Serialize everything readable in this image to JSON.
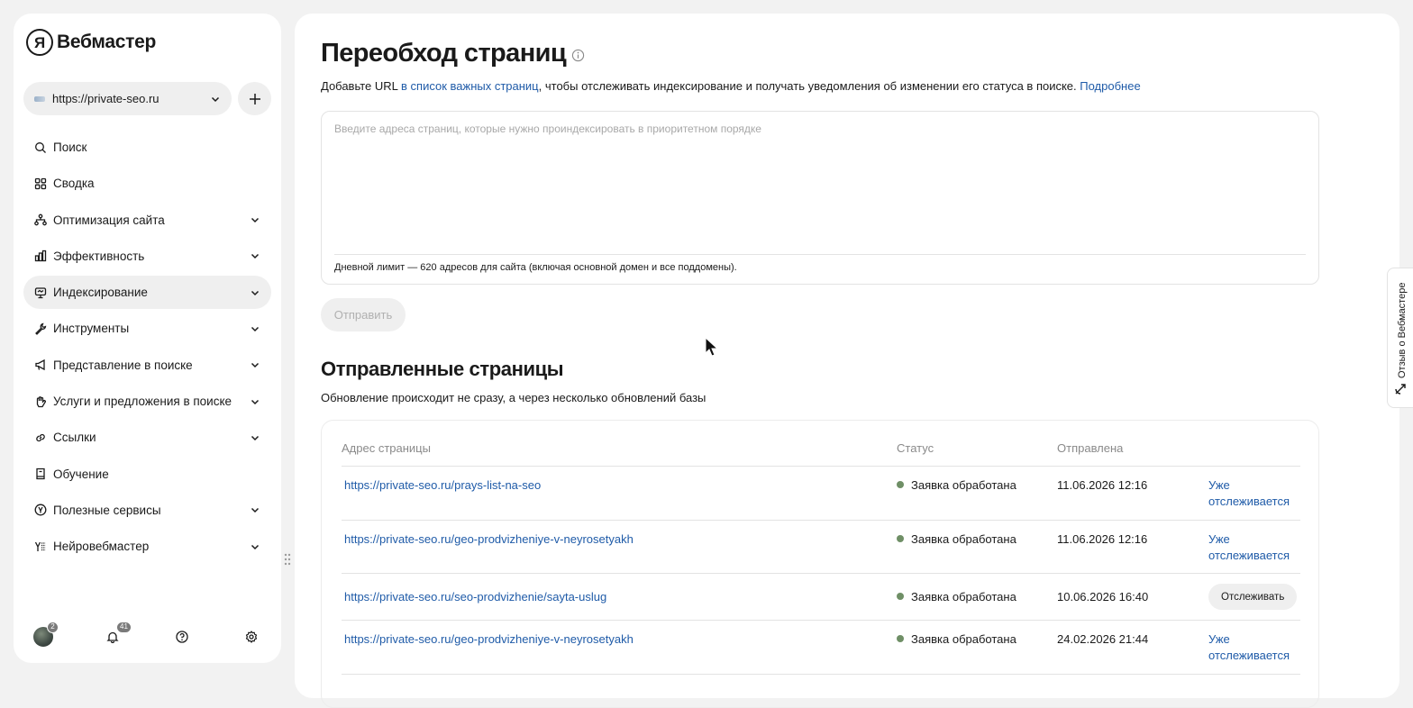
{
  "brand": {
    "logo_letter": "Я",
    "name": "Вебмастер"
  },
  "site_selector": {
    "value": "https://private-seo.ru"
  },
  "nav": [
    {
      "label": "Поиск",
      "icon": "search-icon",
      "expandable": false,
      "active": false
    },
    {
      "label": "Сводка",
      "icon": "grid-icon",
      "expandable": false,
      "active": false
    },
    {
      "label": "Оптимизация сайта",
      "icon": "sitemap-icon",
      "expandable": true,
      "active": false
    },
    {
      "label": "Эффективность",
      "icon": "bar-chart-icon",
      "expandable": true,
      "active": false
    },
    {
      "label": "Индексирование",
      "icon": "monitor-icon",
      "expandable": true,
      "active": true
    },
    {
      "label": "Инструменты",
      "icon": "wrench-icon",
      "expandable": true,
      "active": false
    },
    {
      "label": "Представление в поиске",
      "icon": "megaphone-icon",
      "expandable": true,
      "active": false
    },
    {
      "label": "Услуги и предложения в поиске",
      "icon": "hand-icon",
      "expandable": true,
      "active": false
    },
    {
      "label": "Ссылки",
      "icon": "link-icon",
      "expandable": true,
      "active": false
    },
    {
      "label": "Обучение",
      "icon": "book-icon",
      "expandable": false,
      "active": false
    },
    {
      "label": "Полезные сервисы",
      "icon": "yandex-icon",
      "expandable": true,
      "active": false
    },
    {
      "label": "Нейровебмастер",
      "icon": "neuro-icon",
      "expandable": true,
      "active": false
    }
  ],
  "bottom_bar": {
    "avatar_badge": "2",
    "notifications_badge": "41"
  },
  "page": {
    "title": "Переобход страниц",
    "desc_prefix": "Добавьте URL ",
    "desc_link": "в список важных страниц",
    "desc_suffix": ", чтобы отслеживать индексирование и получать уведомления об изменении его статуса в поиске. ",
    "desc_more": "Подробнее",
    "input_placeholder": "Введите адреса страниц, которые нужно проиндексировать в приоритетном порядке",
    "input_value": "",
    "limit_text": "Дневной лимит — 620 адресов для сайта (включая основной домен и все поддомены).",
    "submit_label": "Отправить"
  },
  "sent": {
    "title": "Отправленные страницы",
    "desc": "Обновление происходит не сразу, а через несколько обновлений базы",
    "columns": {
      "url": "Адрес страницы",
      "status": "Статус",
      "sent": "Отправлена"
    },
    "rows": [
      {
        "url": "https://private-seo.ru/prays-list-na-seo",
        "status": "Заявка обработана",
        "date": "11.06.2026 12:16",
        "action": "Уже отслеживается",
        "action_type": "link"
      },
      {
        "url": "https://private-seo.ru/geo-prodvizheniye-v-neyrosetyakh",
        "status": "Заявка обработана",
        "date": "11.06.2026 12:16",
        "action": "Уже отслеживается",
        "action_type": "link"
      },
      {
        "url": "https://private-seo.ru/seo-prodvizhenie/sayta-uslug",
        "status": "Заявка обработана",
        "date": "10.06.2026 16:40",
        "action": "Отслеживать",
        "action_type": "button"
      },
      {
        "url": "https://private-seo.ru/geo-prodvizheniye-v-neyrosetyakh",
        "status": "Заявка обработана",
        "date": "24.02.2026 21:44",
        "action": "Уже отслеживается",
        "action_type": "link"
      }
    ]
  },
  "feedback_tab": {
    "label": "Отзыв о Вебмастере"
  },
  "colors": {
    "link": "#1f5ba8",
    "status_ok": "#6f8f66",
    "active_bg": "#efefef"
  }
}
